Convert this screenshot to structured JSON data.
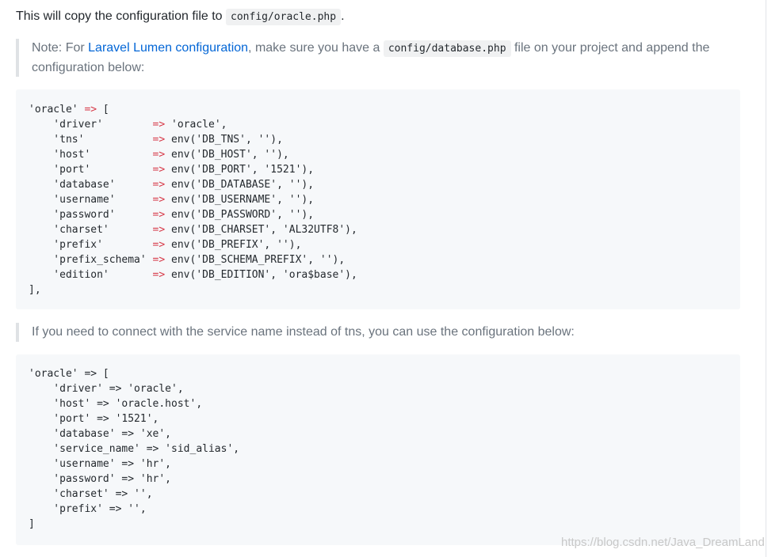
{
  "intro": {
    "text_before": "This will copy the configuration file to ",
    "code": "config/oracle.php",
    "text_after": "."
  },
  "note": {
    "prefix": "Note: For ",
    "link": "Laravel Lumen configuration",
    "middle": ", make sure you have a ",
    "code": "config/database.php",
    "suffix": " file on your project and append the configuration below:"
  },
  "code_block_1": [
    "'oracle' => [",
    "    'driver'        => 'oracle',",
    "    'tns'           => env('DB_TNS', ''),",
    "    'host'          => env('DB_HOST', ''),",
    "    'port'          => env('DB_PORT', '1521'),",
    "    'database'      => env('DB_DATABASE', ''),",
    "    'username'      => env('DB_USERNAME', ''),",
    "    'password'      => env('DB_PASSWORD', ''),",
    "    'charset'       => env('DB_CHARSET', 'AL32UTF8'),",
    "    'prefix'        => env('DB_PREFIX', ''),",
    "    'prefix_schema' => env('DB_SCHEMA_PREFIX', ''),",
    "    'edition'       => env('DB_EDITION', 'ora$base'),",
    "],"
  ],
  "note2": "If you need to connect with the service name instead of tns, you can use the configuration below:",
  "code_block_2": [
    "'oracle' => [",
    "    'driver' => 'oracle',",
    "    'host' => 'oracle.host',",
    "    'port' => '1521',",
    "    'database' => 'xe',",
    "    'service_name' => 'sid_alias',",
    "    'username' => 'hr',",
    "    'password' => 'hr',",
    "    'charset' => '',",
    "    'prefix' => '',",
    "]"
  ],
  "watermark": "https://blog.csdn.net/Java_DreamLand"
}
